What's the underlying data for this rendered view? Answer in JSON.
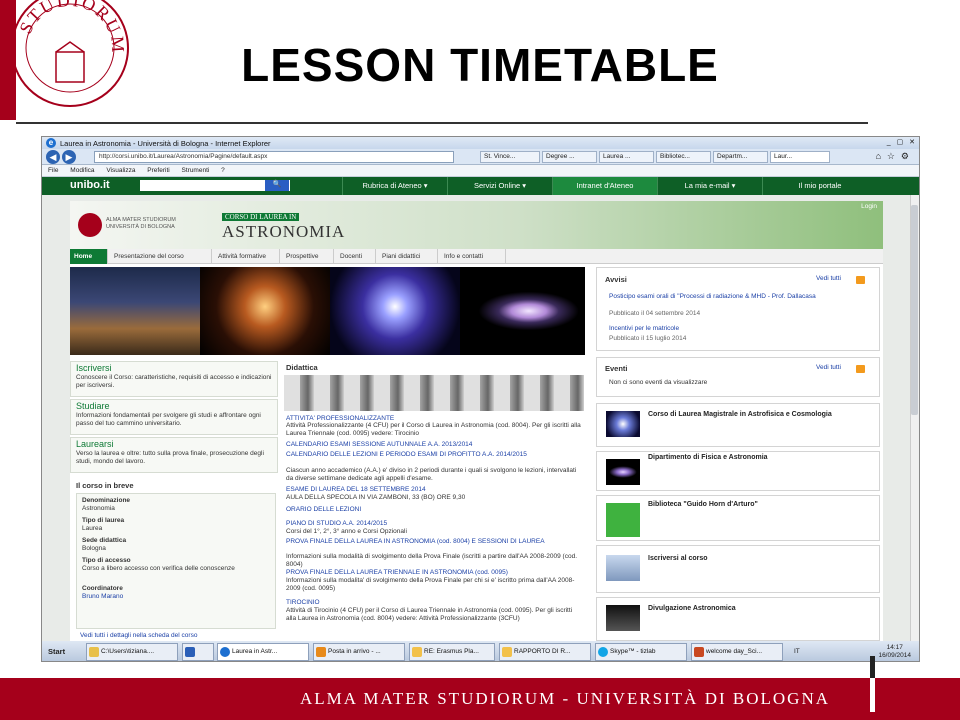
{
  "slide": {
    "title": "LESSON TIMETABLE",
    "footer_text": "ALMA MATER STUDIORUM - UNIVERSITÀ DI BOLOGNA",
    "seal_text": "STUDIORUM"
  },
  "browser": {
    "window_title": "Laurea in Astronomia - Università di Bologna - Internet Explorer",
    "address": "http://corsi.unibo.it/Laurea/Astronomia/Pagine/default.aspx",
    "tabs": [
      "St. Vince...",
      "Degree ...",
      "Laurea ...",
      "Bibliotec...",
      "Departm...",
      "Laur..."
    ],
    "menu": [
      "File",
      "Modifica",
      "Visualizza",
      "Preferiti",
      "Strumenti",
      "?"
    ]
  },
  "unibo_bar": {
    "logo": "unibo.it",
    "search_button": "🔍",
    "items": [
      "Rubrica di Ateneo ▾",
      "Servizi Online ▾",
      "Intranet d'Ateneo",
      "La mia e-mail ▾",
      "Il mio portale"
    ]
  },
  "site": {
    "uni_name": "ALMA MATER STUDIORUM UNIVERSITÀ DI BOLOGNA",
    "corso": "CORSO DI LAUREA IN",
    "astronomia": "ASTRONOMIA",
    "login": "Login",
    "nav": [
      "Home",
      "Presentazione del corso",
      "Attività formative",
      "Prospettive",
      "Docenti",
      "Piani didattici",
      "Info e contatti"
    ],
    "avvisi": {
      "title": "Avvisi",
      "vedi": "Vedi tutti",
      "n1_title": "Posticipo esami orali di \"Processi di radiazione & MHD - Prof. Dallacasa",
      "n1_date": "Pubblicato il 04 settembre 2014",
      "n2_title": "Incentivi per le matricole",
      "n2_date": "Pubblicato il 15 luglio 2014"
    },
    "eventi": {
      "title": "Eventi",
      "vedi": "Vedi tutti",
      "text": "Non ci sono eventi da visualizzare"
    },
    "iscriversi": {
      "h": "Iscriversi",
      "t": "Conoscere il Corso: caratteristiche, requisiti di accesso e indicazioni per iscriversi."
    },
    "studiare": {
      "h": "Studiare",
      "t": "Informazioni fondamentali per svolgere gli studi e affrontare ogni passo del tuo cammino universitario."
    },
    "laurearsi": {
      "h": "Laurearsi",
      "t": "Verso la laurea e oltre: tutto sulla prova finale, prosecuzione degli studi, mondo del lavoro."
    },
    "corso_breve": {
      "title": "Il corso in breve",
      "denominazione_k": "Denominazione",
      "denominazione_v": "Astronomia",
      "tipo_k": "Tipo di laurea",
      "tipo_v": "Laurea",
      "sede_k": "Sede didattica",
      "sede_v": "Bologna",
      "accesso_k": "Tipo di accesso",
      "accesso_v": "Corso a libero accesso con verifica delle conoscenze",
      "coord_k": "Coordinatore",
      "coord_v": "Bruno Marano",
      "vedi": "Vedi tutti i dettagli nella scheda del corso"
    },
    "didattica": {
      "title": "Didattica",
      "l1": "ATTIVITA' PROFESSIONALIZZANTE",
      "t1": "Attività Professionalizzante (4 CFU) per il Corso di Laurea in Astronomia (cod. 8004). Per gli iscritti alla Laurea Triennale (cod. 0095) vedere: Tirocinio",
      "l2": "CALENDARIO ESAMI SESSIONE AUTUNNALE A.A. 2013/2014",
      "l3": "CALENDARIO DELLE LEZIONI E PERIODO ESAMI DI PROFITTO A.A. 2014/2015",
      "t3": "Ciascun anno accademico (A.A.) e' diviso in 2 periodi durante i quali si svolgono le lezioni, intervallati da diverse settimane dedicate agli appelli d'esame.",
      "l4": "ESAME DI LAUREA DEL 18 SETTEMBRE 2014",
      "t4": "AULA DELLA SPECOLA IN VIA ZAMBONI, 33 (BO) ORE 9,30",
      "l5": "ORARIO DELLE LEZIONI",
      "l6": "PIANO DI STUDIO A.A. 2014/2015",
      "t6": "Corsi del 1°, 2°, 3° anno e Corsi Opzionali",
      "l7": "PROVA FINALE DELLA LAUREA IN ASTRONOMIA (cod. 8004) E SESSIONI DI LAUREA",
      "t7": "Informazioni sulla modalità di svolgimento della Prova Finale (iscritti a partire dall'AA 2008-2009 (cod. 8004)",
      "l8": "PROVA FINALE DELLA LAUREA TRIENNALE IN ASTRONOMIA (cod. 0095)",
      "t8": "Informazioni sulla modalita' di svolgimento della Prova Finale per chi si e' iscritto prima dall'AA 2008-2009 (cod. 0095)",
      "l9": "TIROCINIO",
      "t9": "Attività di Tirocinio (4 CFU) per il Corso di Laurea Triennale in Astronomia (cod. 0095). Per gli iscritti alla Laurea in Astronomia (cod. 8004) vedere: Attività Professionalizzante (3CFU)"
    },
    "right_links": [
      "Corso di Laurea Magistrale in Astrofisica e Cosmologia",
      "Dipartimento di Fisica e Astronomia",
      "Biblioteca \"Guido Horn d'Arturo\"",
      "Iscriversi al corso",
      "Divulgazione Astronomica"
    ]
  },
  "taskbar": {
    "start": "Start",
    "items": [
      "C:\\Users\\tiziana....",
      "",
      "Laurea in Astr...",
      "Posta in arrivo - ...",
      "RE: Erasmus Pla...",
      "RAPPORTO DI R...",
      "Skype™ - tizlab",
      "welcome day_Sci..."
    ],
    "lang": "IT",
    "time": "14:17",
    "date": "16/09/2014"
  }
}
